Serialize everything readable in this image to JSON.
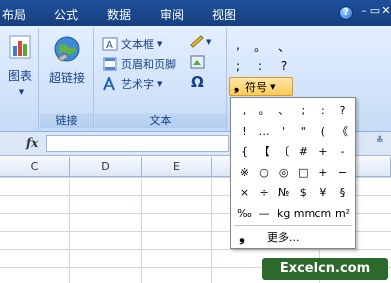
{
  "tabs": [
    "布局",
    "公式",
    "数据",
    "审阅",
    "视图"
  ],
  "window_controls": [
    "–",
    "▭",
    "✕"
  ],
  "help": "?",
  "groups": {
    "chart": {
      "button": "图表"
    },
    "link": {
      "button": "超链接",
      "label": "链接"
    },
    "text": {
      "textbox": "文本框",
      "header_footer": "页眉和页脚",
      "wordart": "艺术字",
      "omega": "Ω",
      "label": "文本"
    }
  },
  "punctuation_rows": [
    [
      ",",
      "。",
      "、"
    ],
    [
      ";",
      ":",
      "?"
    ]
  ],
  "symbol_button": {
    "icon": "❟",
    "label": "符号"
  },
  "formula_bar": {
    "fx": "fx"
  },
  "columns": [
    "C",
    "D",
    "E",
    "F"
  ],
  "symbols": [
    [
      ",",
      "。",
      "、",
      ";",
      ":",
      "?"
    ],
    [
      "!",
      "…",
      "'",
      "\"",
      "(",
      "《"
    ],
    [
      "{",
      "【",
      "〔",
      "#",
      "+",
      "-"
    ],
    [
      "※",
      "○",
      "◎",
      "□",
      "+",
      "−"
    ],
    [
      "×",
      "÷",
      "№",
      "$",
      "¥",
      "§"
    ],
    [
      "‰",
      "—",
      "kg",
      "mm",
      "cm",
      "m²"
    ]
  ],
  "more": {
    "icon": "❟",
    "label": "更多..."
  },
  "watermark": "Excelcn.com"
}
